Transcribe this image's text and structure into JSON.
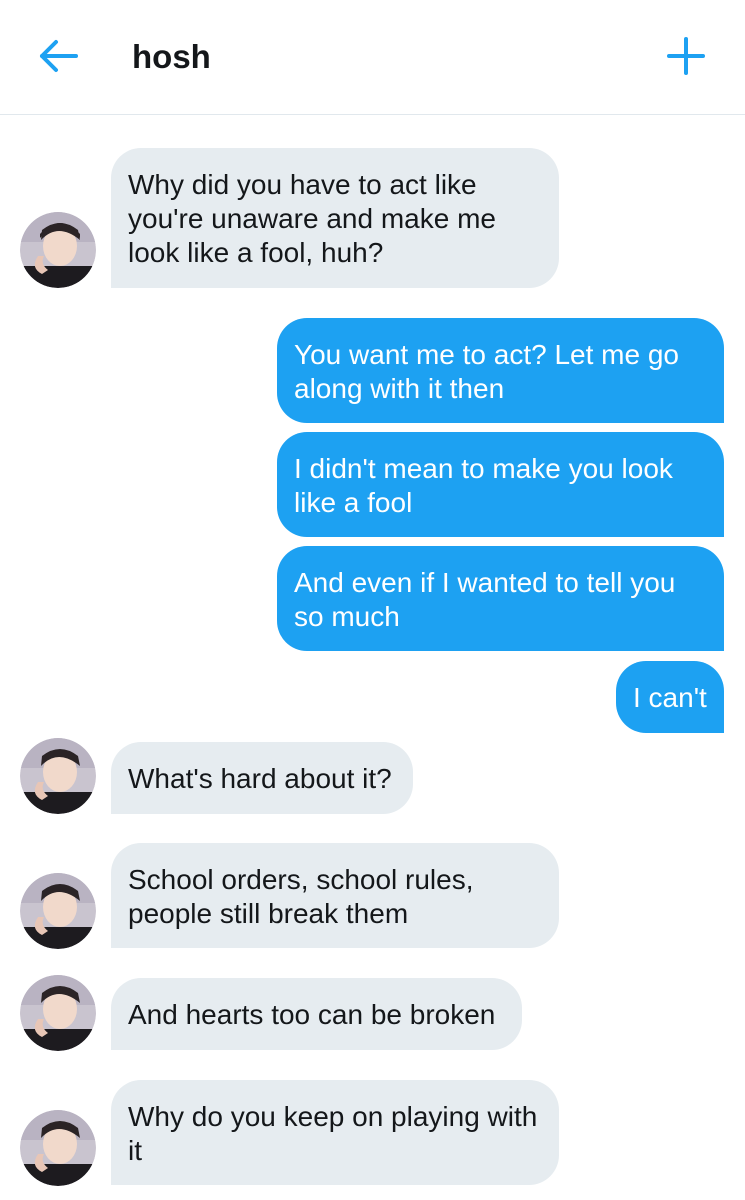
{
  "header": {
    "title": "hosh",
    "back_icon": "arrow-left-icon",
    "new_icon": "plus-icon",
    "accent": "#1da1f2"
  },
  "messages": [
    {
      "from": "them",
      "text": "Why did you have to act like you're unaware and make me look like a fool, huh?"
    },
    {
      "from": "me",
      "text": "You want me to act? Let me go along with it then"
    },
    {
      "from": "me",
      "text": "I didn't mean to make you look like a fool"
    },
    {
      "from": "me",
      "text": "And even if I wanted to tell you so much"
    },
    {
      "from": "me",
      "text": "I can't"
    },
    {
      "from": "them",
      "text": "What's hard about it?"
    },
    {
      "from": "them",
      "text": "School orders, school rules, people still break them"
    },
    {
      "from": "them",
      "text": "And hearts too can be broken"
    },
    {
      "from": "them",
      "text": "Why do you keep on playing with it"
    }
  ],
  "colors": {
    "incoming_bubble": "#e6ecf0",
    "outgoing_bubble": "#1da1f2",
    "divider": "#e1e8ed"
  }
}
